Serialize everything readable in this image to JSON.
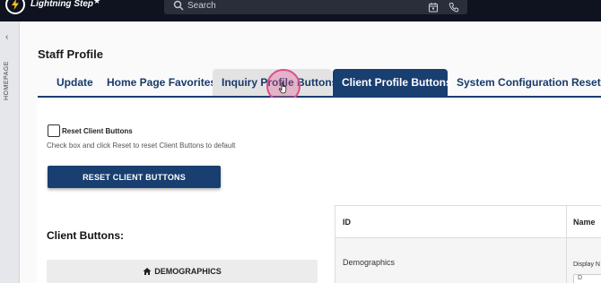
{
  "app": {
    "title": "Lightning Step",
    "search_placeholder": "Search"
  },
  "sidebar": {
    "collapse_glyph": "‹",
    "vertical_label": "HOMEPAGE"
  },
  "page": {
    "title": "Staff Profile"
  },
  "tabs": [
    {
      "label": "Update"
    },
    {
      "label": "Home Page Favorites"
    },
    {
      "label": "Inquiry Profile Buttons"
    },
    {
      "label": "Client Profile Buttons",
      "active": true
    },
    {
      "label": "System Configuration Reset"
    }
  ],
  "reset_section": {
    "checkbox_label": "Reset Client Buttons",
    "hint": "Check box and click Reset to reset Client Buttons to default",
    "button_label": "RESET CLIENT BUTTONS"
  },
  "client_buttons": {
    "title": "Client Buttons:",
    "items": [
      {
        "label": "DEMOGRAPHICS",
        "icon": "home-icon"
      }
    ]
  },
  "table": {
    "headers": {
      "id": "ID",
      "name": "Name"
    },
    "rows": [
      {
        "id": "Demographics",
        "name_label": "Display N",
        "name_value": "D"
      }
    ]
  },
  "colors": {
    "topbar": "#0f1320",
    "accent": "#193e70",
    "cursor_highlight": "#d9508c"
  }
}
